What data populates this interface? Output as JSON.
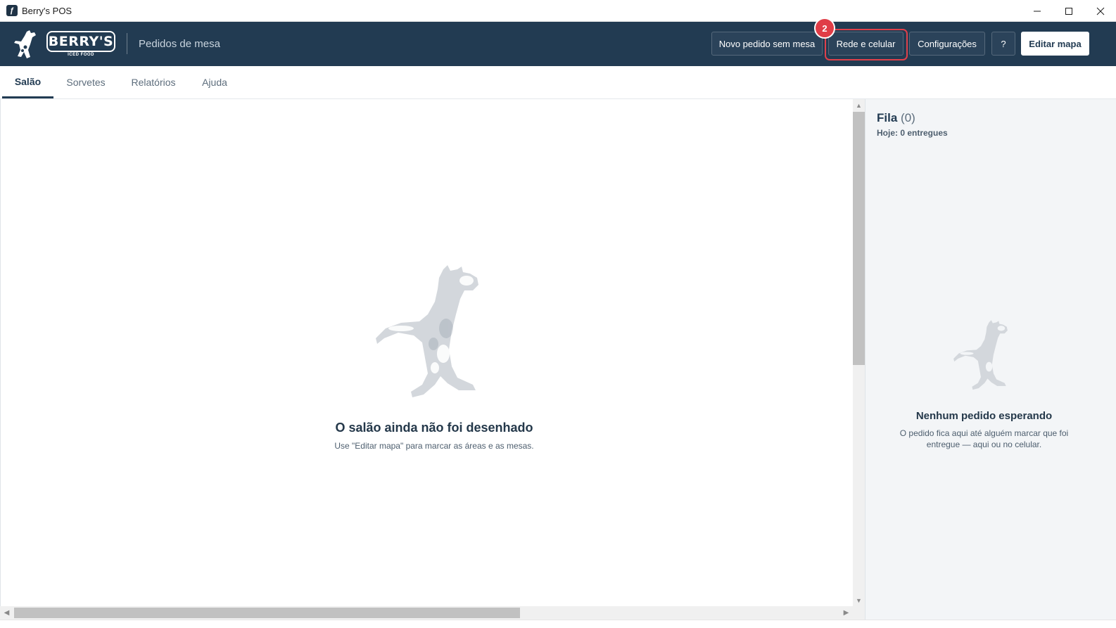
{
  "window": {
    "title": "Berry's POS",
    "icons": [
      "app-icon",
      "minimize-icon",
      "maximize-icon",
      "close-icon"
    ]
  },
  "header": {
    "logo_text": "BERRY'S",
    "logo_subtext": "ICED FOOD",
    "subtitle": "Pedidos de mesa",
    "buttons": {
      "new_order": "Novo pedido sem mesa",
      "network": "Rede e celular",
      "settings": "Configurações",
      "help": "?",
      "edit_map": "Editar mapa"
    },
    "step_badge": "2",
    "colors": {
      "header_bg": "#223b52",
      "highlight": "#e0404a"
    }
  },
  "tabs": [
    {
      "label": "Salão",
      "active": true
    },
    {
      "label": "Sorvetes",
      "active": false
    },
    {
      "label": "Relatórios",
      "active": false
    },
    {
      "label": "Ajuda",
      "active": false
    }
  ],
  "main": {
    "empty_title": "O salão ainda não foi desenhado",
    "empty_desc": "Use \"Editar mapa\" para marcar as áreas e as mesas."
  },
  "queue": {
    "title": "Fila",
    "count": "(0)",
    "today": "Hoje: 0 entregues",
    "empty_title": "Nenhum pedido esperando",
    "empty_desc": "O pedido fica aqui até alguém marcar que foi entregue — aqui ou no celular."
  }
}
